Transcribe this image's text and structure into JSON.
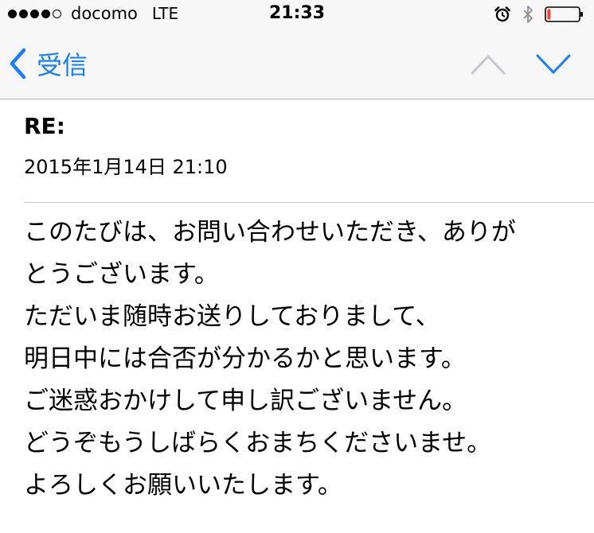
{
  "status_bar": {
    "carrier": "docomo",
    "network": "LTE",
    "time": "21:33",
    "signal": {
      "filled": 4,
      "total": 5
    },
    "battery_level": 0.1,
    "icons": [
      "alarm-icon",
      "bluetooth-icon",
      "battery-icon"
    ]
  },
  "nav": {
    "back_label": "受信",
    "accent_color": "#157efb",
    "disabled_color": "#c7c7cc",
    "icons": [
      "chevron-left-icon",
      "chevron-up-icon",
      "chevron-down-icon"
    ]
  },
  "email": {
    "subject": "RE:",
    "date": "2015年1月14日 21:10",
    "body_lines": [
      "このたびは、お問い合わせいただき、ありが",
      "とうございます。",
      "ただいま随時お送りしておりまして、",
      "明日中には合否が分かるかと思います。",
      "ご迷惑おかけして申し訳ございません。",
      "どうぞもうしばらくおまちくださいませ。",
      "よろしくお願いいたします。"
    ]
  }
}
